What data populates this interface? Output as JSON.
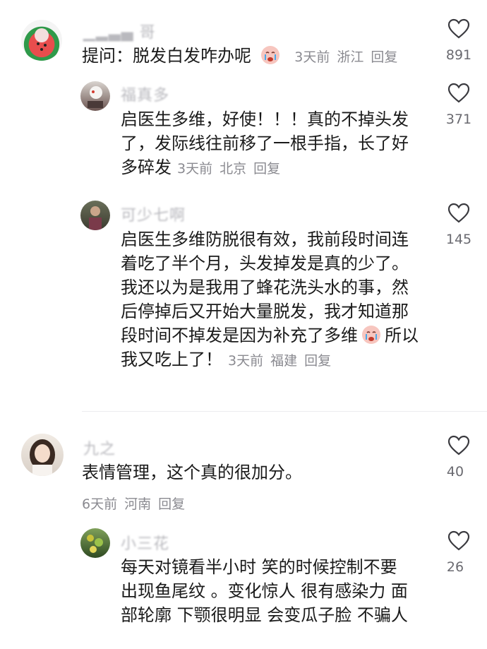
{
  "comments": [
    {
      "author": "▁▂▃▄ 哥",
      "lines": [
        "提问：脱发白发咋办呢"
      ],
      "meta": {
        "time": "3天前",
        "location": "浙江",
        "reply": "回复"
      },
      "likes": "891",
      "reply_icon": "crying-face-emoji"
    },
    {
      "author": "福真多",
      "lines": [
        "启医生多维，好使！！！真的不掉头发",
        "了，发际线往前移了一根手指，长了好",
        "多碎发"
      ],
      "meta": {
        "time": "3天前",
        "location": "北京",
        "reply": "回复"
      },
      "likes": "371"
    },
    {
      "author": "可少七啊",
      "lines": [
        "启医生多维防脱很有效，我前段时间连",
        "着吃了半个月，头发掉发是真的少了。",
        "我还以为是我用了蜂花洗头水的事，然",
        "后停掉后又开始大量脱发，我才知道那",
        "段时间不掉发是因为补充了多维",
        "所以",
        "我又吃上了！"
      ],
      "meta": {
        "time": "3天前",
        "location": "福建",
        "reply": "回复"
      },
      "likes": "145"
    },
    {
      "author": "九之",
      "lines": [
        "表情管理，这个真的很加分。"
      ],
      "meta": {
        "time": "6天前",
        "location": "河南",
        "reply": "回复"
      },
      "likes": "40"
    },
    {
      "author": "小三花",
      "lines": [
        "每天对镜看半小时 笑的时候控制不要",
        "出现鱼尾纹 。变化惊人 很有感染力 面",
        "部轮廓 下颚很明显 会变瓜子脸 不骗人"
      ],
      "likes": "26"
    }
  ]
}
